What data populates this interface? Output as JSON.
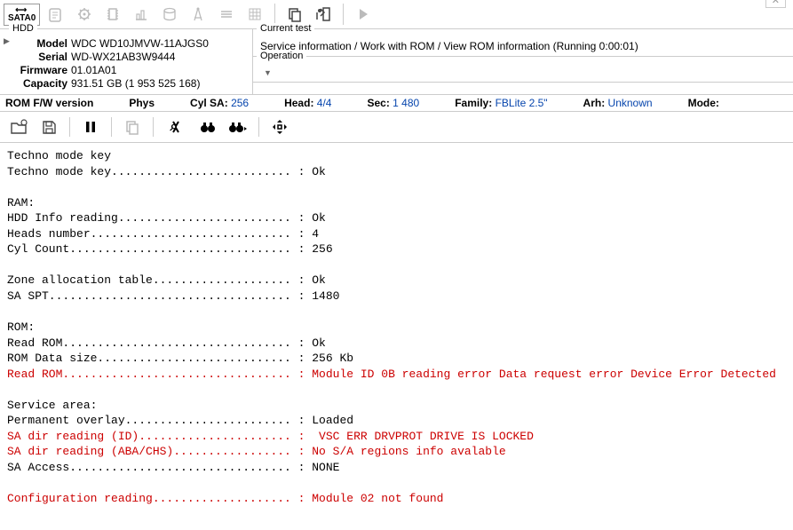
{
  "sata_label": "SATA0",
  "hdd": {
    "title": "HDD",
    "model_label": "Model",
    "model": "WDC WD10JMVW-11AJGS0",
    "serial_label": "Serial",
    "serial": "WD-WX21AB3W9444",
    "firmware_label": "Firmware",
    "firmware": "01.01A01",
    "capacity_label": "Capacity",
    "capacity": "931.51 GB (1 953 525 168)"
  },
  "current_test": {
    "title": "Current test",
    "value": "Service information / Work with ROM / View ROM information (Running 0:00:01)"
  },
  "operation": {
    "title": "Operation",
    "value": ""
  },
  "status": {
    "rom_fw_label": "ROM F/W version",
    "phys_label": "Phys",
    "cylsa_label": "Cyl SA:",
    "cylsa": "256",
    "head_label": "Head:",
    "head": "4/4",
    "sec_label": "Sec:",
    "sec": "1 480",
    "family_label": "Family:",
    "family": "FBLite 2.5\"",
    "arh_label": "Arh:",
    "arh": "Unknown",
    "mode_label": "Mode:"
  },
  "log_lines": [
    {
      "t": "Techno mode key",
      "e": false
    },
    {
      "t": "Techno mode key.......................... : Ok",
      "e": false
    },
    {
      "t": "",
      "e": false
    },
    {
      "t": "RAM:",
      "e": false
    },
    {
      "t": "HDD Info reading......................... : Ok",
      "e": false
    },
    {
      "t": "Heads number............................. : 4",
      "e": false
    },
    {
      "t": "Cyl Count................................ : 256",
      "e": false
    },
    {
      "t": "",
      "e": false
    },
    {
      "t": "Zone allocation table.................... : Ok",
      "e": false
    },
    {
      "t": "SA SPT................................... : 1480",
      "e": false
    },
    {
      "t": "",
      "e": false
    },
    {
      "t": "ROM:",
      "e": false
    },
    {
      "t": "Read ROM................................. : Ok",
      "e": false
    },
    {
      "t": "ROM Data size............................ : 256 Kb",
      "e": false
    },
    {
      "t": "Read ROM................................. : Module ID 0B reading error Data request error Device Error Detected",
      "e": true
    },
    {
      "t": "",
      "e": false
    },
    {
      "t": "Service area:",
      "e": false
    },
    {
      "t": "Permanent overlay........................ : Loaded",
      "e": false
    },
    {
      "t": "SA dir reading (ID)...................... :  VSC ERR DRVPROT DRIVE IS LOCKED",
      "e": true
    },
    {
      "t": "SA dir reading (ABA/CHS)................. : No S/A regions info avalable",
      "e": true
    },
    {
      "t": "SA Access................................ : NONE",
      "e": false
    },
    {
      "t": "",
      "e": false
    },
    {
      "t": "Configuration reading.................... : Module 02 not found",
      "e": true
    }
  ]
}
